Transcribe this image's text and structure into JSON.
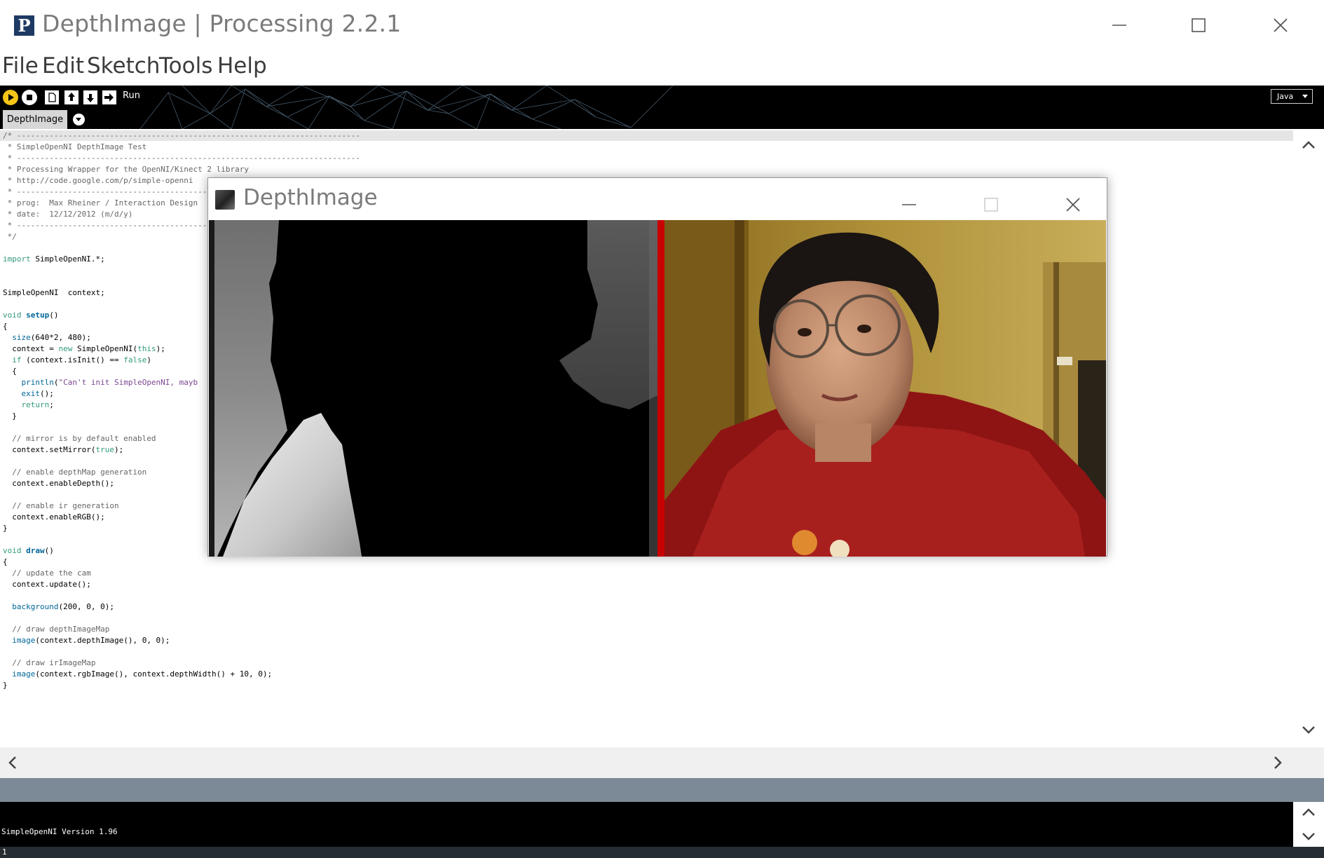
{
  "window": {
    "title": "DepthImage | Processing 2.2.1",
    "logo_glyph": "P",
    "controls": [
      "minimize",
      "maximize",
      "close"
    ]
  },
  "menu": [
    "File",
    "Edit",
    "Sketch",
    "Tools",
    "Help"
  ],
  "toolbar": {
    "buttons": [
      "run-icon",
      "stop-icon",
      "new-icon",
      "open-icon",
      "save-icon",
      "export-icon"
    ],
    "hover_label": "Run",
    "mode": "Java",
    "run_color": "#f5c518"
  },
  "tabs": [
    {
      "label": "DepthImage",
      "active": true
    }
  ],
  "code_lines": [
    [
      {
        "t": "/* --------------------------------------------------------------------------",
        "c": "comment"
      }
    ],
    [
      {
        "t": " * SimpleOpenNI DepthImage Test",
        "c": "comment"
      }
    ],
    [
      {
        "t": " * --------------------------------------------------------------------------",
        "c": "comment"
      }
    ],
    [
      {
        "t": " * Processing Wrapper for the OpenNI/Kinect 2 library",
        "c": "comment"
      }
    ],
    [
      {
        "t": " * http://code.google.com/p/simple-openni",
        "c": "comment"
      }
    ],
    [
      {
        "t": " * --------------------------------------------------------------------------",
        "c": "comment"
      }
    ],
    [
      {
        "t": " * prog:  Max Rheiner / Interaction Design",
        "c": "comment"
      }
    ],
    [
      {
        "t": " * date:  12/12/2012 (m/d/y)",
        "c": "comment"
      }
    ],
    [
      {
        "t": " * --------------------------------------------------------------------------",
        "c": "comment"
      }
    ],
    [
      {
        "t": " */",
        "c": "comment"
      }
    ],
    [],
    [
      {
        "t": "import",
        "c": "keyword"
      },
      {
        "t": " SimpleOpenNI.*;",
        "c": ""
      }
    ],
    [],
    [],
    [
      {
        "t": "SimpleOpenNI  context;",
        "c": ""
      }
    ],
    [],
    [
      {
        "t": "void",
        "c": "keyword"
      },
      {
        "t": " ",
        "c": ""
      },
      {
        "t": "setup",
        "c": "func-b"
      },
      {
        "t": "()",
        "c": ""
      }
    ],
    [
      {
        "t": "{",
        "c": ""
      }
    ],
    [
      {
        "t": "  ",
        "c": ""
      },
      {
        "t": "size",
        "c": "func"
      },
      {
        "t": "(640*2, 480);",
        "c": ""
      }
    ],
    [
      {
        "t": "  context = ",
        "c": ""
      },
      {
        "t": "new",
        "c": "keyword"
      },
      {
        "t": " SimpleOpenNI(",
        "c": ""
      },
      {
        "t": "this",
        "c": "keyword"
      },
      {
        "t": ");",
        "c": ""
      }
    ],
    [
      {
        "t": "  ",
        "c": ""
      },
      {
        "t": "if",
        "c": "keyword"
      },
      {
        "t": " (context.isInit() == ",
        "c": ""
      },
      {
        "t": "false",
        "c": "keyword"
      },
      {
        "t": ")",
        "c": ""
      }
    ],
    [
      {
        "t": "  {",
        "c": ""
      }
    ],
    [
      {
        "t": "    ",
        "c": ""
      },
      {
        "t": "println",
        "c": "func"
      },
      {
        "t": "(",
        "c": ""
      },
      {
        "t": "\"Can't init SimpleOpenNI, mayb",
        "c": "string"
      }
    ],
    [
      {
        "t": "    ",
        "c": ""
      },
      {
        "t": "exit",
        "c": "func"
      },
      {
        "t": "();",
        "c": ""
      }
    ],
    [
      {
        "t": "    ",
        "c": ""
      },
      {
        "t": "return",
        "c": "keyword"
      },
      {
        "t": ";",
        "c": ""
      }
    ],
    [
      {
        "t": "  }",
        "c": ""
      }
    ],
    [],
    [
      {
        "t": "  // mirror is by default enabled",
        "c": "comment"
      }
    ],
    [
      {
        "t": "  context.setMirror(",
        "c": ""
      },
      {
        "t": "true",
        "c": "keyword"
      },
      {
        "t": ");",
        "c": ""
      }
    ],
    [],
    [
      {
        "t": "  // enable depthMap generation",
        "c": "comment"
      }
    ],
    [
      {
        "t": "  context.enableDepth();",
        "c": ""
      }
    ],
    [],
    [
      {
        "t": "  // enable ir generation",
        "c": "comment"
      }
    ],
    [
      {
        "t": "  context.enableRGB();",
        "c": ""
      }
    ],
    [
      {
        "t": "}",
        "c": ""
      }
    ],
    [],
    [
      {
        "t": "void",
        "c": "keyword"
      },
      {
        "t": " ",
        "c": ""
      },
      {
        "t": "draw",
        "c": "func-b"
      },
      {
        "t": "()",
        "c": ""
      }
    ],
    [
      {
        "t": "{",
        "c": ""
      }
    ],
    [
      {
        "t": "  // update the cam",
        "c": "comment"
      }
    ],
    [
      {
        "t": "  context.update();",
        "c": ""
      }
    ],
    [],
    [
      {
        "t": "  ",
        "c": ""
      },
      {
        "t": "background",
        "c": "func"
      },
      {
        "t": "(200, 0, 0);",
        "c": ""
      }
    ],
    [],
    [
      {
        "t": "  // draw depthImageMap",
        "c": "comment"
      }
    ],
    [
      {
        "t": "  ",
        "c": ""
      },
      {
        "t": "image",
        "c": "func"
      },
      {
        "t": "(context.depthImage(), 0, 0);",
        "c": ""
      }
    ],
    [],
    [
      {
        "t": "  // draw irImageMap",
        "c": "comment"
      }
    ],
    [
      {
        "t": "  ",
        "c": ""
      },
      {
        "t": "image",
        "c": "func"
      },
      {
        "t": "(context.rgbImage(), context.depthWidth() + 10, 0);",
        "c": ""
      }
    ],
    [
      {
        "t": "}",
        "c": ""
      }
    ]
  ],
  "console": {
    "text": "SimpleOpenNI Version 1.96"
  },
  "line_status": "1",
  "sketch_window": {
    "title": "DepthImage",
    "background_color": "#c80000"
  }
}
